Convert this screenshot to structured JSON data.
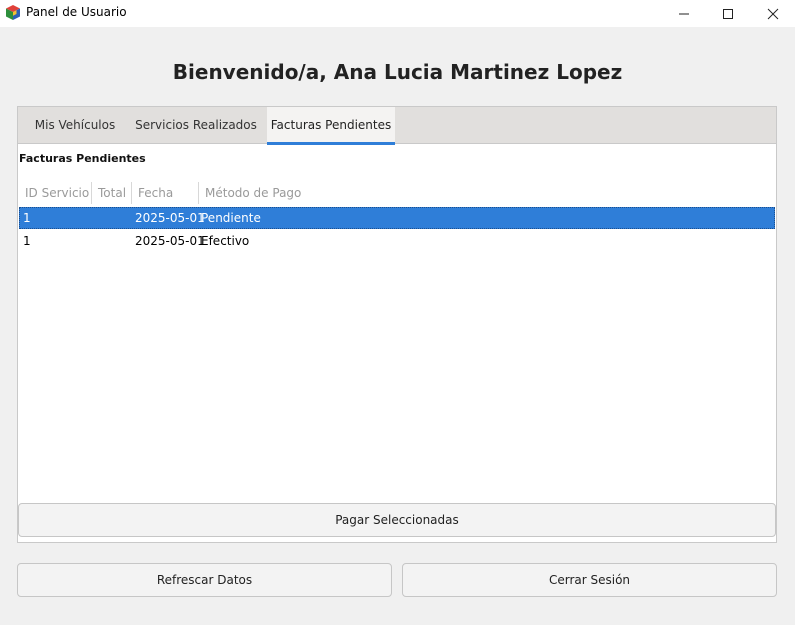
{
  "window": {
    "title": "Panel de Usuario",
    "icon": "cube-icon"
  },
  "header": {
    "welcome": "Bienvenido/a, Ana Lucia Martinez Lopez"
  },
  "tabs": [
    {
      "label": "Mis Vehículos",
      "active": false
    },
    {
      "label": "Servicios Realizados",
      "active": false
    },
    {
      "label": "Facturas Pendientes",
      "active": true
    }
  ],
  "facturas": {
    "section_title": "Facturas Pendientes",
    "columns": [
      "ID Servicio",
      "Total",
      "Fecha",
      "Método de Pago"
    ],
    "rows": [
      {
        "id_servicio": "1",
        "total": "",
        "fecha": "2025-05-01",
        "metodo": "Pendiente",
        "selected": true
      },
      {
        "id_servicio": "1",
        "total": "",
        "fecha": "2025-05-01",
        "metodo": "Efectivo",
        "selected": false
      }
    ],
    "pay_button": "Pagar Seleccionadas"
  },
  "actions": {
    "refresh": "Refrescar Datos",
    "logout": "Cerrar Sesión"
  },
  "colors": {
    "accent": "#2f7ed8",
    "tab_bar": "#e1dfdd",
    "background": "#f0f0f0"
  }
}
